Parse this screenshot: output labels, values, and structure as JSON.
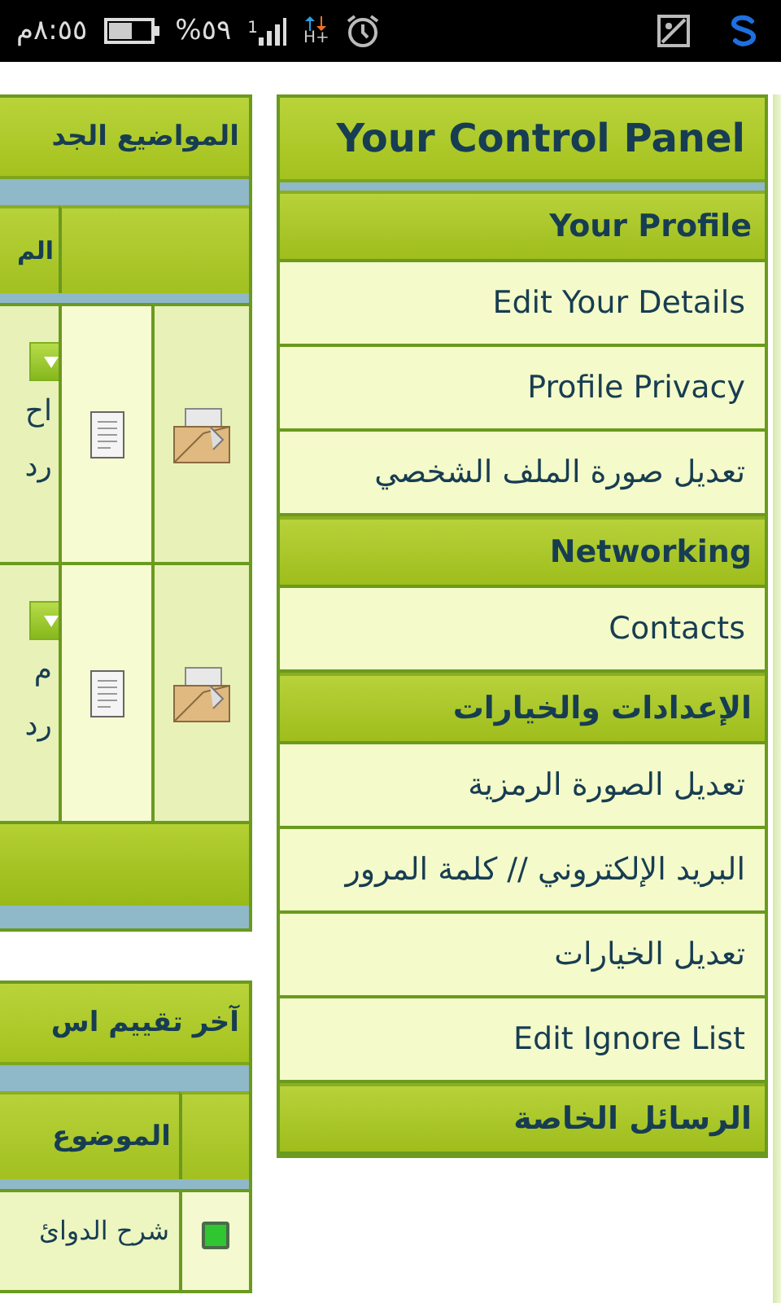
{
  "status_bar": {
    "time": "٨:٥٥م",
    "battery_percent": "%٥٩",
    "sim": "1",
    "network": "H+"
  },
  "new_topics": {
    "title": "المواضيع الجد",
    "columns": [
      "الم"
    ],
    "rows": [
      {
        "lines": [
          "اح",
          "رد"
        ]
      },
      {
        "lines": [
          "م",
          "رد"
        ]
      }
    ]
  },
  "ratings": {
    "title": "آخر تقييم اس",
    "columns": [
      "الموضوع"
    ],
    "rows": [
      {
        "title": "شرح الدوائ"
      }
    ]
  },
  "control_panel": {
    "title": "Your Control Panel",
    "sections": [
      {
        "title": "Your Profile",
        "items": [
          "Edit Your Details",
          "Profile Privacy",
          "تعديل صورة الملف الشخصي"
        ]
      },
      {
        "title": "Networking",
        "items": [
          "Contacts"
        ]
      },
      {
        "title": "الإعدادات والخيارات",
        "items": [
          "تعديل الصورة الرمزية",
          "البريد الإلكتروني // كلمة المرور",
          "تعديل الخيارات",
          "Edit Ignore List"
        ]
      },
      {
        "title": "الرسائل الخاصة"
      }
    ]
  }
}
